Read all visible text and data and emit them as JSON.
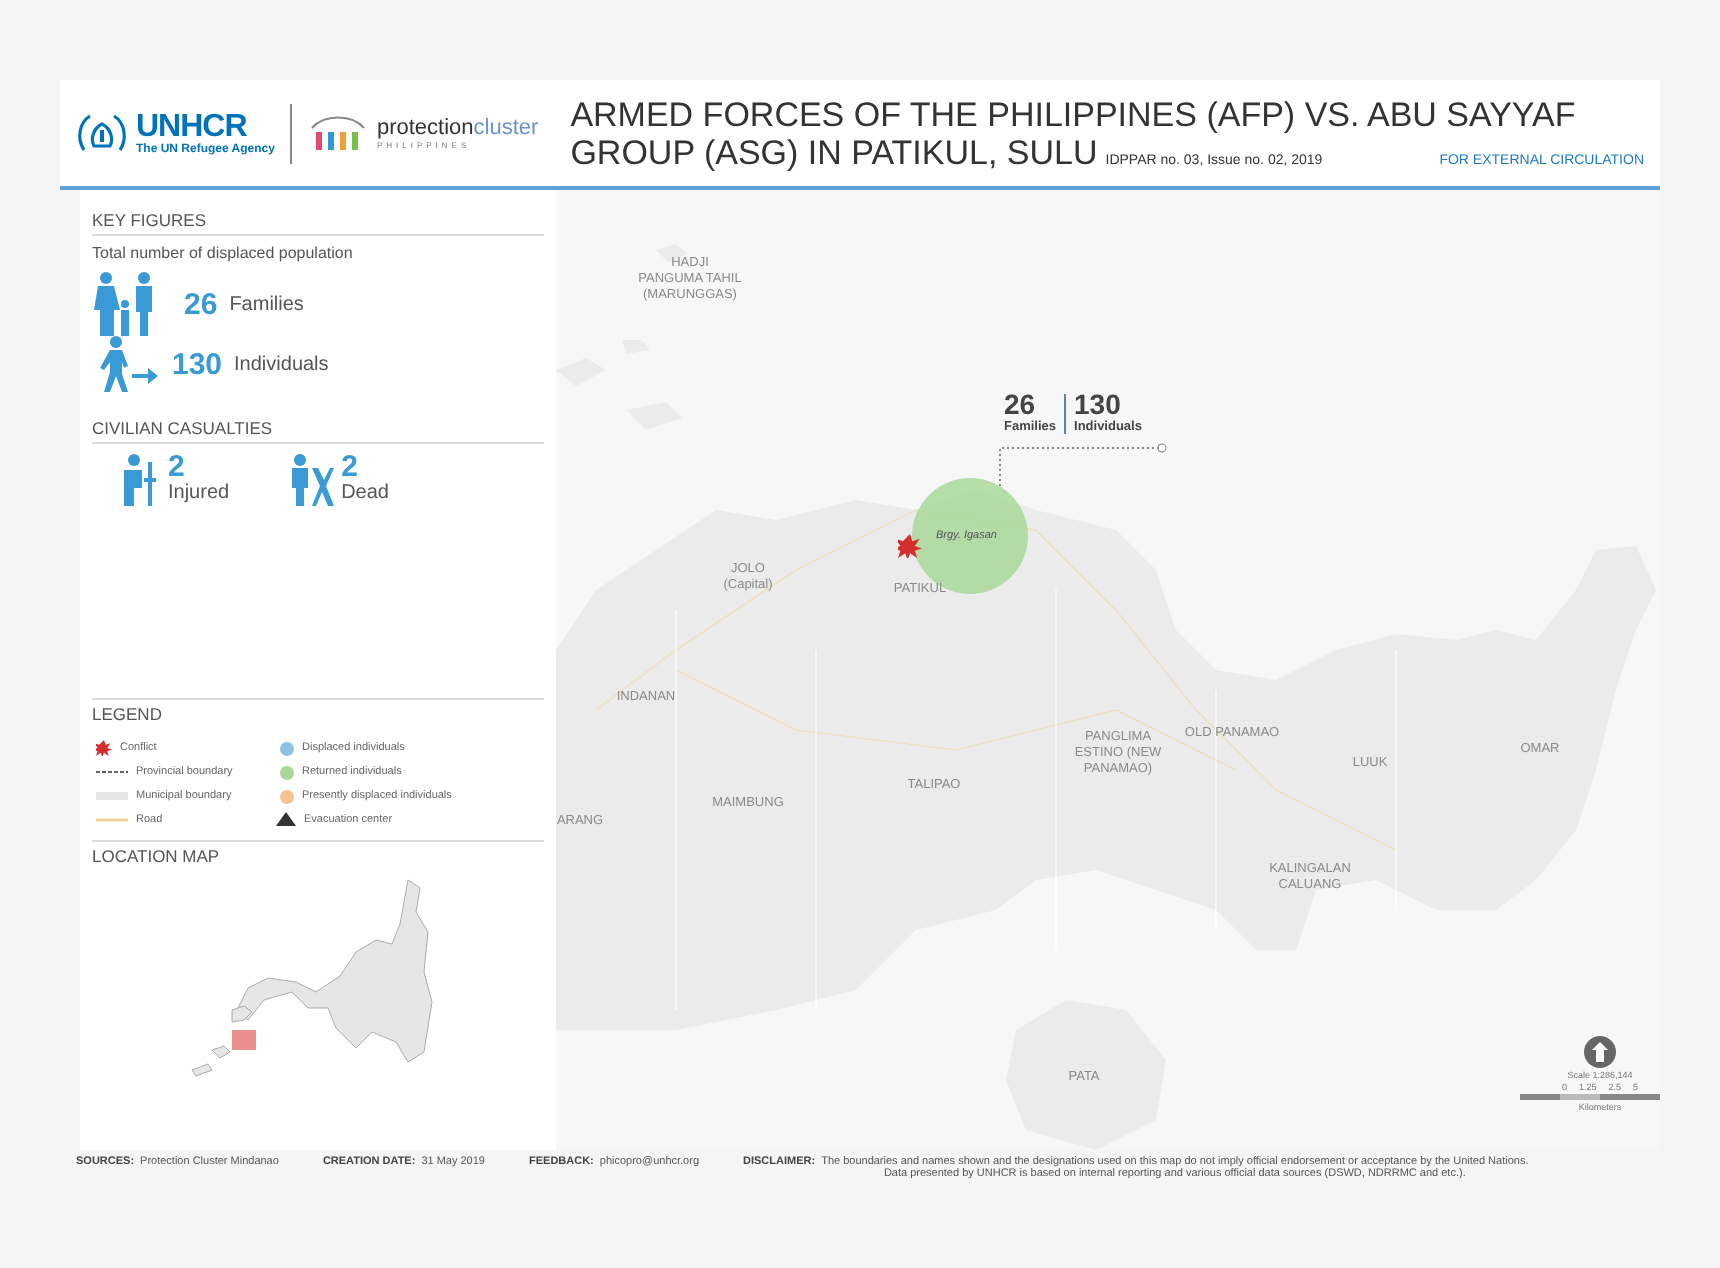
{
  "header": {
    "org_name": "UNHCR",
    "org_tagline": "The UN Refugee Agency",
    "cluster_word_1": "protection",
    "cluster_word_2": "cluster",
    "cluster_country": "PHILIPPINES",
    "title_line_1": "ARMED FORCES OF THE PHILIPPINES (AFP) VS. ABU SAYYAF",
    "title_line_2": "GROUP (ASG)  IN PATIKUL, SULU",
    "issue": "IDPPAR no. 03, Issue no. 02, 2019",
    "circulation": "FOR EXTERNAL CIRCULATION"
  },
  "key_figures": {
    "heading": "KEY FIGURES",
    "subtitle": "Total number of displaced population",
    "items": [
      {
        "kind": "family",
        "value": "26",
        "label": "Families"
      },
      {
        "kind": "individual",
        "value": "130",
        "label": "Individuals"
      }
    ]
  },
  "casualties": {
    "heading": "CIVILIAN CASUALTIES",
    "items": [
      {
        "kind": "injured",
        "value": "2",
        "label": "Injured"
      },
      {
        "kind": "dead",
        "value": "2",
        "label": "Dead"
      }
    ]
  },
  "legend": {
    "heading": "LEGEND",
    "items": [
      {
        "kind": "conflict",
        "label": "Conflict"
      },
      {
        "kind": "provincial",
        "label": "Provincial boundary"
      },
      {
        "kind": "municipal",
        "label": "Municipal boundary"
      },
      {
        "kind": "road",
        "label": "Road"
      },
      {
        "kind": "dot",
        "label": "Displaced individuals",
        "color": "#8fc1e3"
      },
      {
        "kind": "dot",
        "label": "Returned individuals",
        "color": "#a8d89a"
      },
      {
        "kind": "dot",
        "label": "Presently displaced individuals",
        "color": "#f5c390"
      },
      {
        "kind": "evacuation",
        "label": "Evacuation center"
      }
    ]
  },
  "location_map": {
    "heading": "LOCATION MAP"
  },
  "map": {
    "places": [
      {
        "label": "HADJI\nPANGUMA TAHIL\n(MARUNGGAS)"
      },
      {
        "label": "JOLO\n(Capital)"
      },
      {
        "label": "PATIKUL"
      },
      {
        "label": "INDANAN"
      },
      {
        "label": "TALIPAO"
      },
      {
        "label": "MAIMBUNG"
      },
      {
        "label": "ARANG"
      },
      {
        "label": "PANGLIMA\nESTINO (NEW\nPANAMAO)"
      },
      {
        "label": "OLD PANAMAO"
      },
      {
        "label": "LUUK"
      },
      {
        "label": "OMAR"
      },
      {
        "label": "KALINGALAN\nCALUANG"
      },
      {
        "label": "PATA"
      }
    ],
    "barangay": "Brgy. Igasan",
    "callout": {
      "families_value": "26",
      "families_label": "Families",
      "individuals_value": "130",
      "individuals_label": "Individuals"
    },
    "scale": {
      "label": "Scale",
      "ratio": "1:286,144",
      "ticks": [
        "0",
        "1.25",
        "2.5",
        "5"
      ],
      "unit": "Kilometers"
    }
  },
  "footer": {
    "items": [
      {
        "label": "SOURCES:",
        "value": "Protection Cluster Mindanao"
      },
      {
        "label": "CREATION DATE:",
        "value": "31 May  2019"
      },
      {
        "label": "FEEDBACK:",
        "value": "phicopro@unhcr.org"
      }
    ],
    "disclaimer": {
      "label": "DISCLAIMER:",
      "line_1": "The boundaries and names shown and the designations used on this map do not imply official endorsement or acceptance by the United Nations.",
      "line_2": "Data presented by UNHCR is based on internal reporting and various official data sources (DSWD, NDRRMC and etc.)."
    }
  }
}
